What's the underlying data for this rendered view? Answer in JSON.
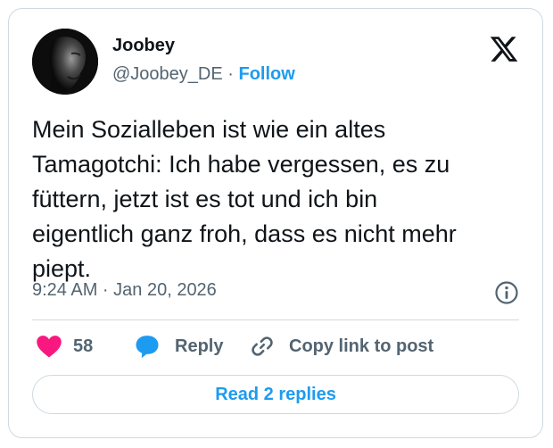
{
  "author": {
    "name": "Joobey",
    "handle": "@Joobey_DE",
    "separator": "·",
    "follow_label": "Follow"
  },
  "tweet": {
    "text": "Mein Sozialleben ist wie ein altes\nTamagotchi: Ich habe vergessen, es zu\nfüttern, jetzt ist es tot und ich bin\neigentlich ganz froh, dass es nicht mehr\npiept.",
    "timestamp": "9:24 AM · Jan 20, 2026"
  },
  "actions": {
    "like_count": "58",
    "reply_label": "Reply",
    "copy_link_label": "Copy link to post"
  },
  "read_replies_label": "Read 2 replies",
  "icons": {
    "logo": "x-logo-icon",
    "info": "info-icon",
    "like": "heart-icon",
    "reply": "speech-bubble-icon",
    "copy": "link-icon"
  },
  "colors": {
    "accent": "#1d9bf0",
    "like": "#f91880",
    "muted": "#536471",
    "text": "#0f1419",
    "border": "#cfd9de"
  }
}
